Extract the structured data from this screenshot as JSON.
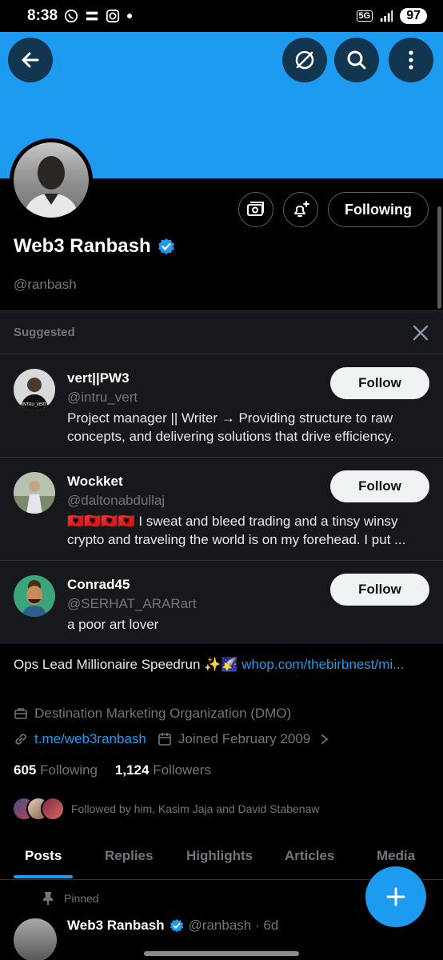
{
  "status_bar": {
    "time": "8:38",
    "battery": "97",
    "network": "5G",
    "icons": [
      "whatsapp-icon",
      "sim-icon",
      "instagram-icon",
      "dot-icon",
      "signal-icon"
    ]
  },
  "header": {
    "banner_color": "#1d9bf0",
    "back_icon": "arrow-left-icon",
    "grok_icon": "grok-icon",
    "search_icon": "search-icon",
    "more_icon": "more-vertical-icon"
  },
  "profile": {
    "name": "Web3 Ranbash",
    "handle": "@ranbash",
    "verified": true,
    "following_button": "Following",
    "bio_text": "Ops Lead Millionaire Speedrun ✨🌠 ",
    "bio_link": "whop.com/thebirbnest/mi...",
    "category": "Destination Marketing Organization (DMO)",
    "website": "t.me/web3ranbash",
    "joined": "Joined February 2009",
    "following_count": "605",
    "following_label": "Following",
    "followers_count": "1,124",
    "followers_label": "Followers",
    "followed_by": "Followed by him, Kasim Jaja and David Stabenaw"
  },
  "suggested": {
    "title": "Suggested",
    "follow_label": "Follow",
    "users": [
      {
        "name": "vert||PW3",
        "handle": "@intru_vert",
        "bio": "Project manager || Writer  →  Providing structure to raw concepts, and  delivering solutions that drive efficiency."
      },
      {
        "name": "Wockket",
        "handle": "@daltonabdullaj",
        "bio": "🇦🇱🇦🇱🇦🇱🇦🇱 I sweat and bleed trading and a tinsy winsy crypto and traveling the world is on my forehead. I put ..."
      },
      {
        "name": "Conrad45",
        "handle": "@SERHAT_ARARart",
        "bio": "a poor art lover"
      }
    ]
  },
  "tabs": [
    {
      "label": "Posts",
      "active": true
    },
    {
      "label": "Replies",
      "active": false
    },
    {
      "label": "Highlights",
      "active": false
    },
    {
      "label": "Articles",
      "active": false
    },
    {
      "label": "Media",
      "active": false
    }
  ],
  "pinned_post": {
    "pinned_label": "Pinned",
    "author": "Web3 Ranbash",
    "handle_time": "@ranbash · 6d"
  }
}
